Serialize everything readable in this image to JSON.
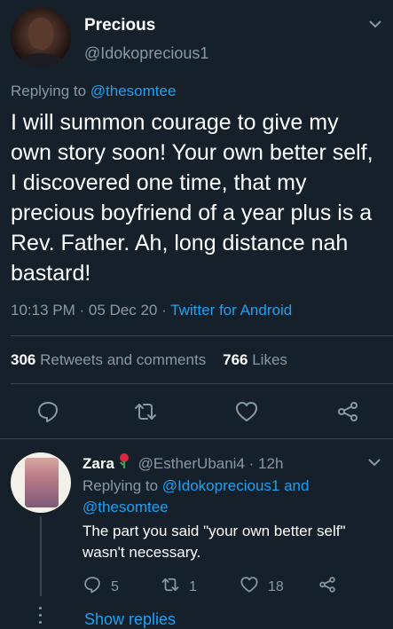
{
  "tweet": {
    "author_name": "Precious",
    "author_handle": "@Idokoprecious1",
    "replying_prefix": "Replying to",
    "replying_to": "@thesomtee",
    "text": "I will summon courage to give my own story soon! Your own better self, I discovered one time, that my precious boyfriend of a year plus is a Rev. Father.  Ah, long distance nah bastard!",
    "time": "10:13 PM · 05 Dec 20 · ",
    "source": "Twitter for Android",
    "retweets_count": "306",
    "retweets_label": "Retweets and comments",
    "likes_count": "766",
    "likes_label": "Likes"
  },
  "reply": {
    "author_name": "Zara",
    "author_handle": "@EstherUbani4",
    "age": "· 12h",
    "replying_prefix": "Replying to",
    "replying_to_1": "@Idokoprecious1",
    "replying_and": "and",
    "replying_to_2": "@thesomtee",
    "text": "The part you said \"your own better self\" wasn't necessary.",
    "reply_count": "5",
    "retweet_count": "1",
    "like_count": "18",
    "show_replies": "Show replies"
  },
  "colors": {
    "background": "#15202b",
    "accent": "#1da1f2",
    "muted": "#8899a6",
    "divider": "#38444d"
  },
  "icons": [
    "chevron-down-icon",
    "reply-icon",
    "retweet-icon",
    "like-icon",
    "share-icon",
    "rose-emoji"
  ]
}
